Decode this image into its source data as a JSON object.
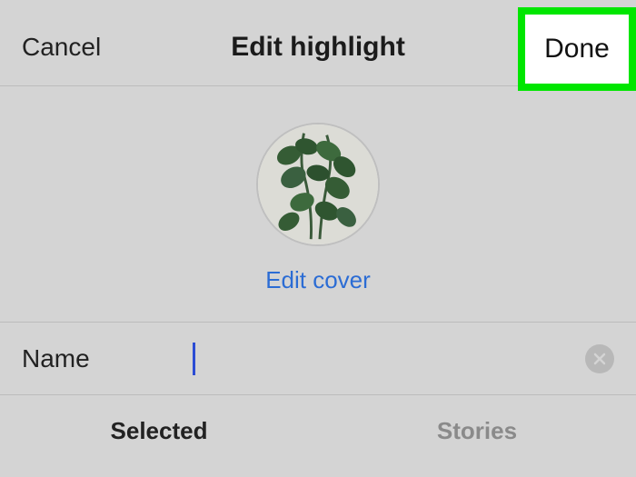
{
  "header": {
    "cancel": "Cancel",
    "title": "Edit highlight",
    "done": "Done"
  },
  "cover": {
    "edit_link": "Edit cover"
  },
  "name_row": {
    "label": "Name",
    "value": ""
  },
  "tabs": {
    "selected": "Selected",
    "stories": "Stories"
  },
  "annotation": {
    "highlight_color": "#00e600"
  }
}
